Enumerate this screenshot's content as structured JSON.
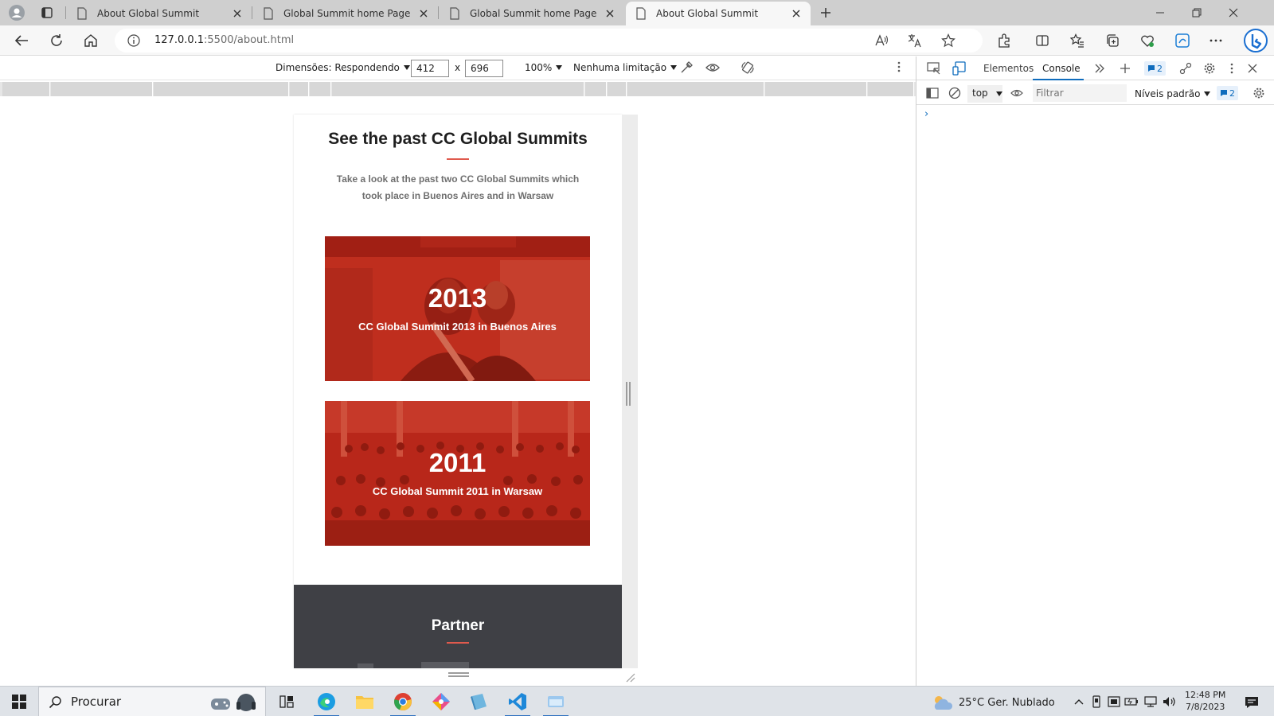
{
  "tabs": [
    {
      "title": "About Global Summit",
      "active": false
    },
    {
      "title": "Global Summit home Page",
      "active": false
    },
    {
      "title": "Global Summit home Page",
      "active": false
    },
    {
      "title": "About Global Summit",
      "active": true
    }
  ],
  "address": {
    "url_host": "127.0.0.1",
    "url_path": ":5500/about.html"
  },
  "device_toolbar": {
    "dimensions_label": "Dimensões: Respondendo",
    "width": "412",
    "height": "696",
    "separator": "x",
    "zoom": "100%",
    "throttling": "Nenhuma limitação"
  },
  "page": {
    "title": "See the past CC Global Summits",
    "subtitle": "Take a look at the past two CC Global Summits which took place in Buenos Aires and in Warsaw",
    "summits": [
      {
        "year": "2013",
        "caption": "CC Global Summit 2013 in Buenos Aires"
      },
      {
        "year": "2011",
        "caption": "CC Global Summit 2011 in Warsaw"
      }
    ],
    "partner_title": "Partner",
    "accent_color": "#e05a4d",
    "overlay_color": "#b8291c",
    "partner_bg": "#3f4045"
  },
  "devtools": {
    "tab_elements": "Elementos",
    "tab_console": "Console",
    "issues_count": "2",
    "context": "top",
    "filter_placeholder": "Filtrar",
    "levels": "Níveis padrão",
    "messages_count": "2",
    "prompt": "›"
  },
  "taskbar": {
    "search_label": "Procurar",
    "weather": "25°C  Ger. Nublado",
    "time": "12:48 PM",
    "date": "7/8/2023"
  }
}
